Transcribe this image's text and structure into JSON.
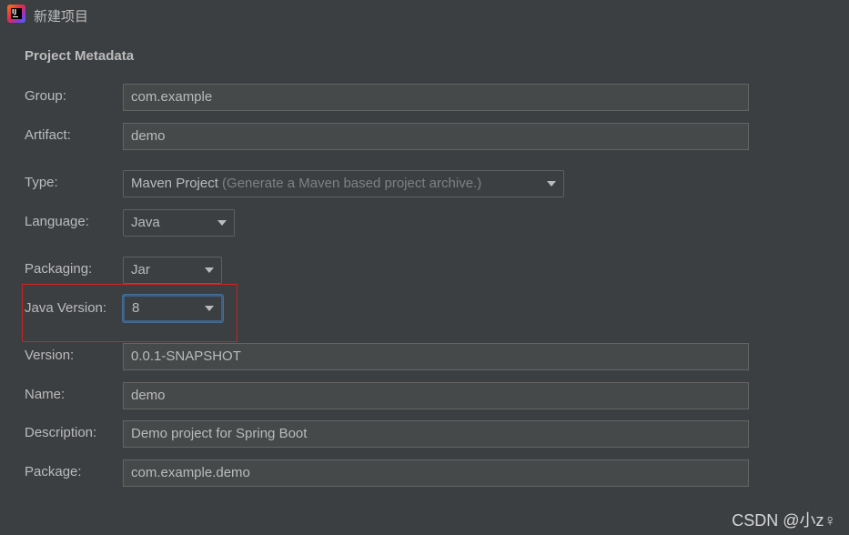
{
  "window": {
    "title": "新建项目"
  },
  "section_title": "Project Metadata",
  "fields": {
    "group": {
      "label": "Group:",
      "value": "com.example"
    },
    "artifact": {
      "label": "Artifact:",
      "value": "demo"
    },
    "type": {
      "label": "Type:",
      "value": "Maven Project",
      "hint": "(Generate a Maven based project archive.)"
    },
    "language": {
      "label": "Language:",
      "value": "Java"
    },
    "packaging": {
      "label": "Packaging:",
      "value": "Jar"
    },
    "java_version": {
      "label": "Java Version:",
      "value": "8"
    },
    "version": {
      "label": "Version:",
      "value": "0.0.1-SNAPSHOT"
    },
    "name": {
      "label": "Name:",
      "value": "demo"
    },
    "description": {
      "label": "Description:",
      "value": "Demo project for Spring Boot"
    },
    "package": {
      "label": "Package:",
      "value": "com.example.demo"
    }
  },
  "watermark": "CSDN @小z♀",
  "colors": {
    "background": "#3c3f41",
    "field_bg": "#45494a",
    "focus": "#3d6185",
    "highlight": "#d02020"
  }
}
